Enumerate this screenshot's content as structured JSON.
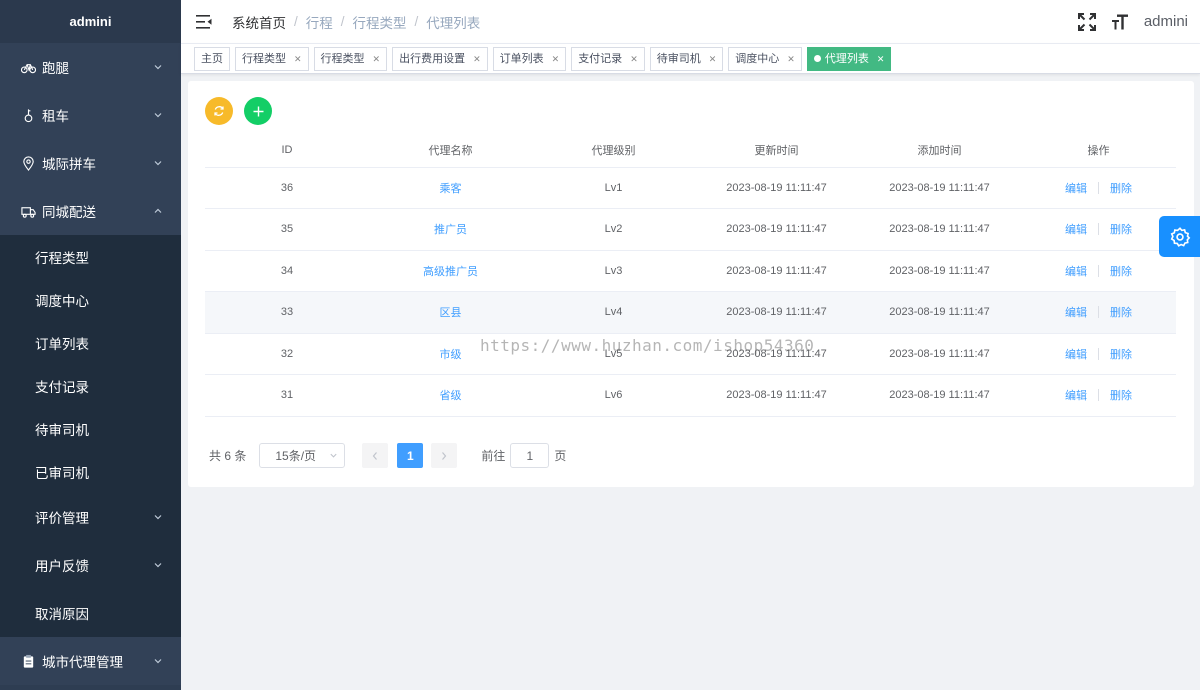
{
  "sidebar": {
    "logo": "admini",
    "groups": [
      {
        "label": "跑腿",
        "icon": "bicycle-icon"
      },
      {
        "label": "租车",
        "icon": "key-icon"
      },
      {
        "label": "城际拼车",
        "icon": "location-icon"
      },
      {
        "label": "同城配送",
        "icon": "truck-icon",
        "expanded": true
      }
    ],
    "subitems": [
      "行程类型",
      "调度中心",
      "订单列表",
      "支付记录",
      "待审司机",
      "已审司机"
    ],
    "collapsible_subitems": [
      "评价管理",
      "用户反馈"
    ],
    "plain_subitem": "取消原因",
    "bottom_group": {
      "label": "城市代理管理",
      "icon": "clipboard-icon"
    }
  },
  "header": {
    "breadcrumb": [
      "系统首页",
      "行程",
      "行程类型",
      "代理列表"
    ],
    "user": "admini"
  },
  "tags": [
    {
      "label": "主页",
      "closable": false
    },
    {
      "label": "行程类型",
      "closable": true
    },
    {
      "label": "行程类型",
      "closable": true
    },
    {
      "label": "出行费用设置",
      "closable": true
    },
    {
      "label": "订单列表",
      "closable": true
    },
    {
      "label": "支付记录",
      "closable": true
    },
    {
      "label": "待审司机",
      "closable": true
    },
    {
      "label": "调度中心",
      "closable": true
    },
    {
      "label": "代理列表",
      "closable": true,
      "active": true
    }
  ],
  "table": {
    "headers": [
      "ID",
      "代理名称",
      "代理级别",
      "更新时间",
      "添加时间",
      "操作"
    ],
    "rows": [
      {
        "id": "36",
        "name": "乘客",
        "level": "Lv1",
        "updated": "2023-08-19 11:11:47",
        "added": "2023-08-19 11:11:47"
      },
      {
        "id": "35",
        "name": "推广员",
        "level": "Lv2",
        "updated": "2023-08-19 11:11:47",
        "added": "2023-08-19 11:11:47"
      },
      {
        "id": "34",
        "name": "高级推广员",
        "level": "Lv3",
        "updated": "2023-08-19 11:11:47",
        "added": "2023-08-19 11:11:47"
      },
      {
        "id": "33",
        "name": "区县",
        "level": "Lv4",
        "updated": "2023-08-19 11:11:47",
        "added": "2023-08-19 11:11:47"
      },
      {
        "id": "32",
        "name": "市级",
        "level": "Lv5",
        "updated": "2023-08-19 11:11:47",
        "added": "2023-08-19 11:11:47"
      },
      {
        "id": "31",
        "name": "省级",
        "level": "Lv6",
        "updated": "2023-08-19 11:11:47",
        "added": "2023-08-19 11:11:47"
      }
    ],
    "edit_label": "编辑",
    "delete_label": "删除"
  },
  "pager": {
    "total": "共 6 条",
    "page_size": "15条/页",
    "current_page": "1",
    "goto_prefix": "前往",
    "goto_value": "1",
    "goto_suffix": "页"
  },
  "watermark": "https://www.huzhan.com/ishop54360",
  "colors": {
    "sidebar": "#324157",
    "active_tag": "#42b983",
    "primary": "#409eff"
  }
}
